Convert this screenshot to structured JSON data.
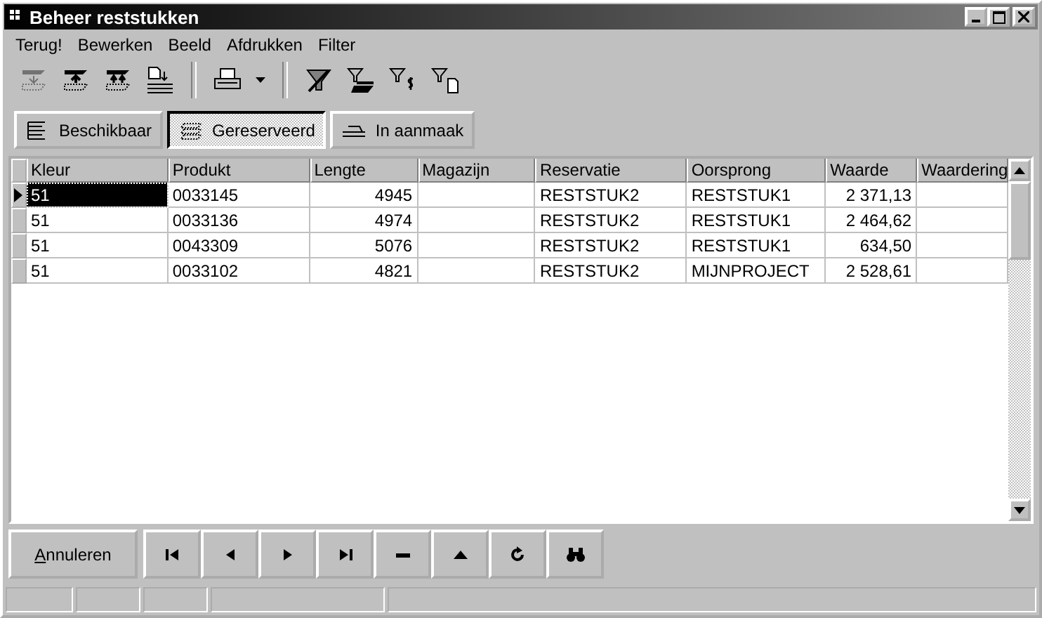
{
  "window": {
    "title": "Beheer reststukken"
  },
  "menu": [
    "Terug!",
    "Bewerken",
    "Beeld",
    "Afdrukken",
    "Filter"
  ],
  "toolbar": [
    {
      "kind": "down",
      "disabled": true
    },
    {
      "kind": "up",
      "disabled": false
    },
    {
      "kind": "upall",
      "disabled": false
    },
    {
      "kind": "docmove",
      "disabled": false
    },
    {
      "kind": "sep"
    },
    {
      "kind": "print",
      "disabled": false
    },
    {
      "kind": "sep"
    },
    {
      "kind": "filteroff",
      "disabled": false
    },
    {
      "kind": "filterstack",
      "disabled": false
    },
    {
      "kind": "filtermoney",
      "disabled": false
    },
    {
      "kind": "filterdoc",
      "disabled": false
    }
  ],
  "tabs": [
    {
      "label": "Beschikbaar",
      "kind": "list",
      "selected": false
    },
    {
      "label": "Gereserveerd",
      "kind": "hatch",
      "selected": true
    },
    {
      "label": "In aanmaak",
      "kind": "build",
      "selected": false
    }
  ],
  "table": {
    "columns": [
      "Kleur",
      "Produkt",
      "Lengte",
      "Magazijn",
      "Reservatie",
      "Oorsprong",
      "Waarde",
      "Waardering"
    ],
    "rows": [
      {
        "selected": true,
        "cells": [
          "51",
          "0033145",
          "4945",
          "",
          "RESTSTUK2",
          "RESTSTUK1",
          "2 371,13",
          ""
        ]
      },
      {
        "selected": false,
        "cells": [
          "51",
          "0033136",
          "4974",
          "",
          "RESTSTUK2",
          "RESTSTUK1",
          "2 464,62",
          ""
        ]
      },
      {
        "selected": false,
        "cells": [
          "51",
          "0043309",
          "5076",
          "",
          "RESTSTUK2",
          "RESTSTUK1",
          "634,50",
          ""
        ]
      },
      {
        "selected": false,
        "cells": [
          "51",
          "0033102",
          "4821",
          "",
          "RESTSTUK2",
          "MIJNPROJECT",
          "2 528,61",
          ""
        ]
      }
    ]
  },
  "cancel_button": "Annuleren",
  "navigator": [
    {
      "kind": "first"
    },
    {
      "kind": "prior"
    },
    {
      "kind": "next"
    },
    {
      "kind": "last"
    },
    {
      "kind": "delete"
    },
    {
      "kind": "post"
    },
    {
      "kind": "refresh"
    },
    {
      "kind": "find"
    }
  ]
}
